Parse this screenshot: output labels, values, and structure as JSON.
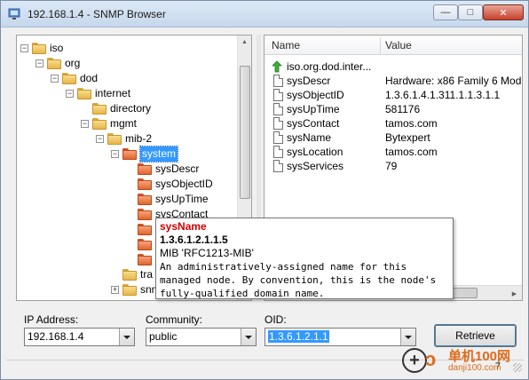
{
  "window": {
    "title": "192.168.1.4 - SNMP Browser",
    "minimize_glyph": "—",
    "maximize_glyph": "□",
    "close_glyph": "✕"
  },
  "tree": {
    "items": [
      {
        "label": "iso",
        "color": "yellow",
        "expander": "−",
        "depth": 0
      },
      {
        "label": "org",
        "color": "yellow",
        "expander": "−",
        "depth": 1
      },
      {
        "label": "dod",
        "color": "yellow",
        "expander": "−",
        "depth": 2
      },
      {
        "label": "internet",
        "color": "yellow",
        "expander": "−",
        "depth": 3
      },
      {
        "label": "directory",
        "color": "yellow",
        "expander": "",
        "depth": 4
      },
      {
        "label": "mgmt",
        "color": "yellow",
        "expander": "−",
        "depth": 4
      },
      {
        "label": "mib-2",
        "color": "yellow",
        "expander": "−",
        "depth": 5
      },
      {
        "label": "system",
        "color": "orange",
        "expander": "−",
        "depth": 6,
        "selected": true
      },
      {
        "label": "sysDescr",
        "color": "orange",
        "expander": "",
        "depth": 7
      },
      {
        "label": "sysObjectID",
        "color": "orange",
        "expander": "",
        "depth": 7
      },
      {
        "label": "sysUpTime",
        "color": "orange",
        "expander": "",
        "depth": 7
      },
      {
        "label": "sysContact",
        "color": "orange",
        "expander": "",
        "depth": 7
      },
      {
        "label": "sysName",
        "color": "orange",
        "expander": "",
        "depth": 7
      },
      {
        "label": "sysLocation",
        "color": "orange",
        "expander": "",
        "depth": 7
      },
      {
        "label": "sysServices",
        "color": "orange",
        "expander": "",
        "depth": 7
      },
      {
        "label": "tra",
        "color": "yellow",
        "expander": "",
        "depth": 6
      },
      {
        "label": "snm",
        "color": "yellow",
        "expander": "+",
        "depth": 6
      }
    ]
  },
  "list": {
    "columns": {
      "name": "Name",
      "value": "Value"
    },
    "rows": [
      {
        "icon": "up-level-icon",
        "name": "iso.org.dod.inter...",
        "value": ""
      },
      {
        "icon": "document-icon",
        "name": "sysDescr",
        "value": "Hardware: x86 Family 6 Mod"
      },
      {
        "icon": "document-icon",
        "name": "sysObjectID",
        "value": "1.3.6.1.4.1.311.1.1.3.1.1"
      },
      {
        "icon": "document-icon",
        "name": "sysUpTime",
        "value": "581176"
      },
      {
        "icon": "document-icon",
        "name": "sysContact",
        "value": "tamos.com"
      },
      {
        "icon": "document-icon",
        "name": "sysName",
        "value": "Bytexpert"
      },
      {
        "icon": "document-icon",
        "name": "sysLocation",
        "value": "tamos.com"
      },
      {
        "icon": "document-icon",
        "name": "sysServices",
        "value": "79"
      }
    ]
  },
  "tooltip": {
    "title": "sysName",
    "oid": "1.3.6.1.2.1.1.5",
    "mib": "MIB 'RFC1213-MIB'",
    "description": "An administratively-assigned name for this\nmanaged node. By convention, this is the node's\nfully-qualified domain name."
  },
  "form": {
    "ip_label": "IP Address:",
    "ip_value": "192.168.1.4",
    "community_label": "Community:",
    "community_value": "public",
    "oid_label": "OID:",
    "oid_value": "1.3.6.1.2.1.1",
    "retrieve_label": "Retrieve"
  },
  "status": {
    "text": "7"
  },
  "watermark": {
    "cn": "单机100网",
    "url": "danji100.com",
    "circle": "+"
  },
  "colors": {
    "selection": "#3399ff",
    "tooltip_title": "#cc0000",
    "folder_yellow": "#e8b64a",
    "folder_orange": "#e2652f"
  }
}
